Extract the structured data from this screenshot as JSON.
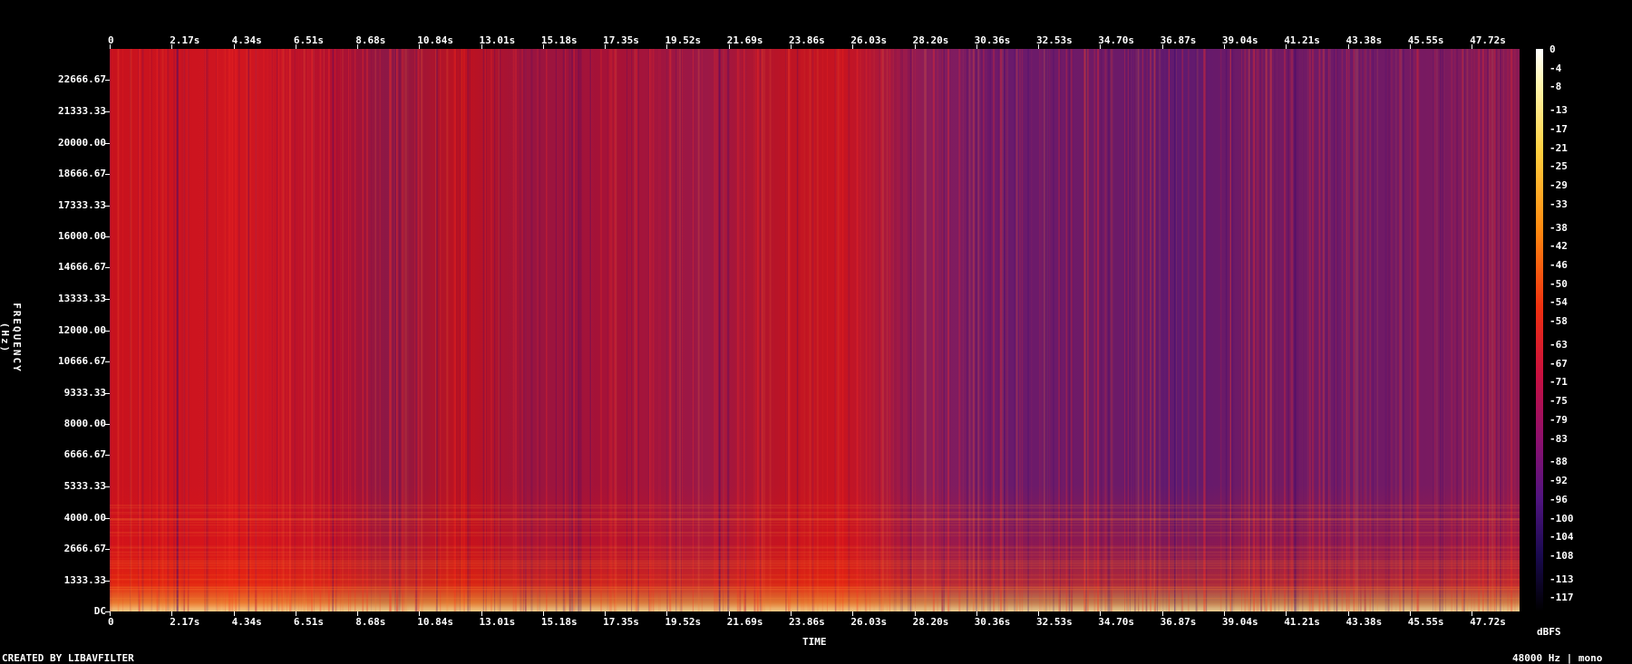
{
  "chart_data": {
    "type": "heatmap",
    "xlabel": "TIME",
    "ylabel": "FREQUENCY (Hz)",
    "x_ticks": [
      "0",
      "2.17s",
      "4.34s",
      "6.51s",
      "8.68s",
      "10.84s",
      "13.01s",
      "15.18s",
      "17.35s",
      "19.52s",
      "21.69s",
      "23.86s",
      "26.03s",
      "28.20s",
      "30.36s",
      "32.53s",
      "34.70s",
      "36.87s",
      "39.04s",
      "41.21s",
      "43.38s",
      "45.55s",
      "47.72s"
    ],
    "x_tick_values": [
      0,
      2.17,
      4.34,
      6.51,
      8.68,
      10.84,
      13.01,
      15.18,
      17.35,
      19.52,
      21.69,
      23.86,
      26.03,
      28.2,
      30.36,
      32.53,
      34.7,
      36.87,
      39.04,
      41.21,
      43.38,
      45.55,
      47.72
    ],
    "xlim": [
      0,
      49.4
    ],
    "y_ticks": [
      "22666.67",
      "21333.33",
      "20000.00",
      "18666.67",
      "17333.33",
      "16000.00",
      "14666.67",
      "13333.33",
      "12000.00",
      "10666.67",
      "9333.33",
      "8000.00",
      "6666.67",
      "5333.33",
      "4000.00",
      "2666.67",
      "1333.33",
      "DC"
    ],
    "y_tick_values": [
      22666.67,
      21333.33,
      20000,
      18666.67,
      17333.33,
      16000,
      14666.67,
      13333.33,
      12000,
      10666.67,
      9333.33,
      8000,
      6666.67,
      5333.33,
      4000,
      2666.67,
      1333.33,
      0
    ],
    "ylim": [
      0,
      24000
    ],
    "colorbar_label": "dBFS",
    "colorbar_ticks": [
      "0",
      "-4",
      "-8",
      "-13",
      "-17",
      "-21",
      "-25",
      "-29",
      "-33",
      "-38",
      "-42",
      "-46",
      "-50",
      "-54",
      "-58",
      "-63",
      "-67",
      "-71",
      "-75",
      "-79",
      "-83",
      "-88",
      "-92",
      "-96",
      "-100",
      "-104",
      "-108",
      "-113",
      "-117"
    ],
    "colorbar_tick_values": [
      0,
      -4,
      -8,
      -13,
      -17,
      -21,
      -25,
      -29,
      -33,
      -38,
      -42,
      -46,
      -50,
      -54,
      -58,
      -63,
      -67,
      -71,
      -75,
      -79,
      -83,
      -88,
      -92,
      -96,
      -100,
      -104,
      -108,
      -113,
      -117
    ],
    "colorbar_range": [
      -120,
      0
    ],
    "colors": {
      "high": "#ffffff",
      "mid": "#f03010",
      "low": "#000000"
    }
  },
  "footer": {
    "credit": "CREATED BY LIBAVFILTER",
    "info": "48000 Hz | mono"
  }
}
